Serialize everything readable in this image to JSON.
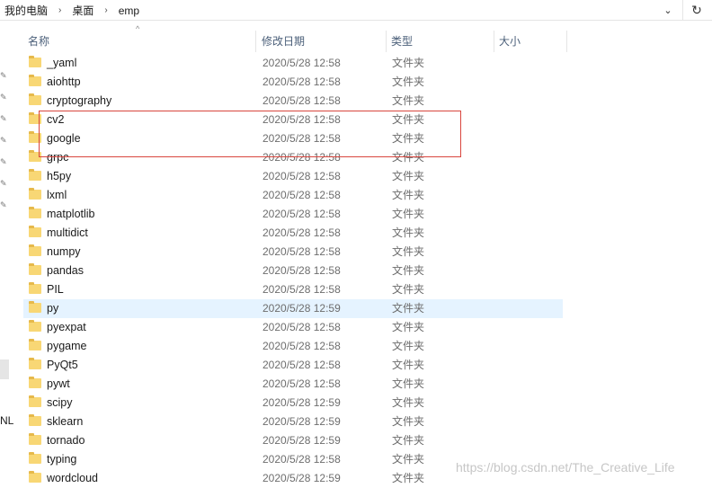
{
  "breadcrumb": {
    "items": [
      "我的电脑",
      "桌面",
      "emp"
    ],
    "separator": "›"
  },
  "addressbar": {
    "dropdown_glyph": "⌄",
    "refresh_glyph": "↻"
  },
  "navpane": {
    "label_fragment": "NL"
  },
  "columns": {
    "name": "名称",
    "date": "修改日期",
    "type": "类型",
    "size": "大小"
  },
  "files": [
    {
      "name": "_yaml",
      "date": "2020/5/28 12:58",
      "type": "文件夹"
    },
    {
      "name": "aiohttp",
      "date": "2020/5/28 12:58",
      "type": "文件夹"
    },
    {
      "name": "cryptography",
      "date": "2020/5/28 12:58",
      "type": "文件夹"
    },
    {
      "name": "cv2",
      "date": "2020/5/28 12:58",
      "type": "文件夹"
    },
    {
      "name": "google",
      "date": "2020/5/28 12:58",
      "type": "文件夹"
    },
    {
      "name": "grpc",
      "date": "2020/5/28 12:58",
      "type": "文件夹"
    },
    {
      "name": "h5py",
      "date": "2020/5/28 12:58",
      "type": "文件夹"
    },
    {
      "name": "lxml",
      "date": "2020/5/28 12:58",
      "type": "文件夹"
    },
    {
      "name": "matplotlib",
      "date": "2020/5/28 12:58",
      "type": "文件夹"
    },
    {
      "name": "multidict",
      "date": "2020/5/28 12:58",
      "type": "文件夹"
    },
    {
      "name": "numpy",
      "date": "2020/5/28 12:58",
      "type": "文件夹"
    },
    {
      "name": "pandas",
      "date": "2020/5/28 12:58",
      "type": "文件夹"
    },
    {
      "name": "PIL",
      "date": "2020/5/28 12:58",
      "type": "文件夹"
    },
    {
      "name": "py",
      "date": "2020/5/28 12:59",
      "type": "文件夹",
      "selected": true
    },
    {
      "name": "pyexpat",
      "date": "2020/5/28 12:58",
      "type": "文件夹"
    },
    {
      "name": "pygame",
      "date": "2020/5/28 12:58",
      "type": "文件夹"
    },
    {
      "name": "PyQt5",
      "date": "2020/5/28 12:58",
      "type": "文件夹"
    },
    {
      "name": "pywt",
      "date": "2020/5/28 12:58",
      "type": "文件夹"
    },
    {
      "name": "scipy",
      "date": "2020/5/28 12:59",
      "type": "文件夹"
    },
    {
      "name": "sklearn",
      "date": "2020/5/28 12:59",
      "type": "文件夹"
    },
    {
      "name": "tornado",
      "date": "2020/5/28 12:59",
      "type": "文件夹"
    },
    {
      "name": "typing",
      "date": "2020/5/28 12:58",
      "type": "文件夹"
    },
    {
      "name": "wordcloud",
      "date": "2020/5/28 12:59",
      "type": "文件夹"
    }
  ],
  "colors": {
    "folder": "#f8d775",
    "selection": "#e5f3ff",
    "highlight_box": "#d9463e",
    "header_text": "#4c607a"
  },
  "watermark": "https://blog.csdn.net/The_Creative_Life"
}
